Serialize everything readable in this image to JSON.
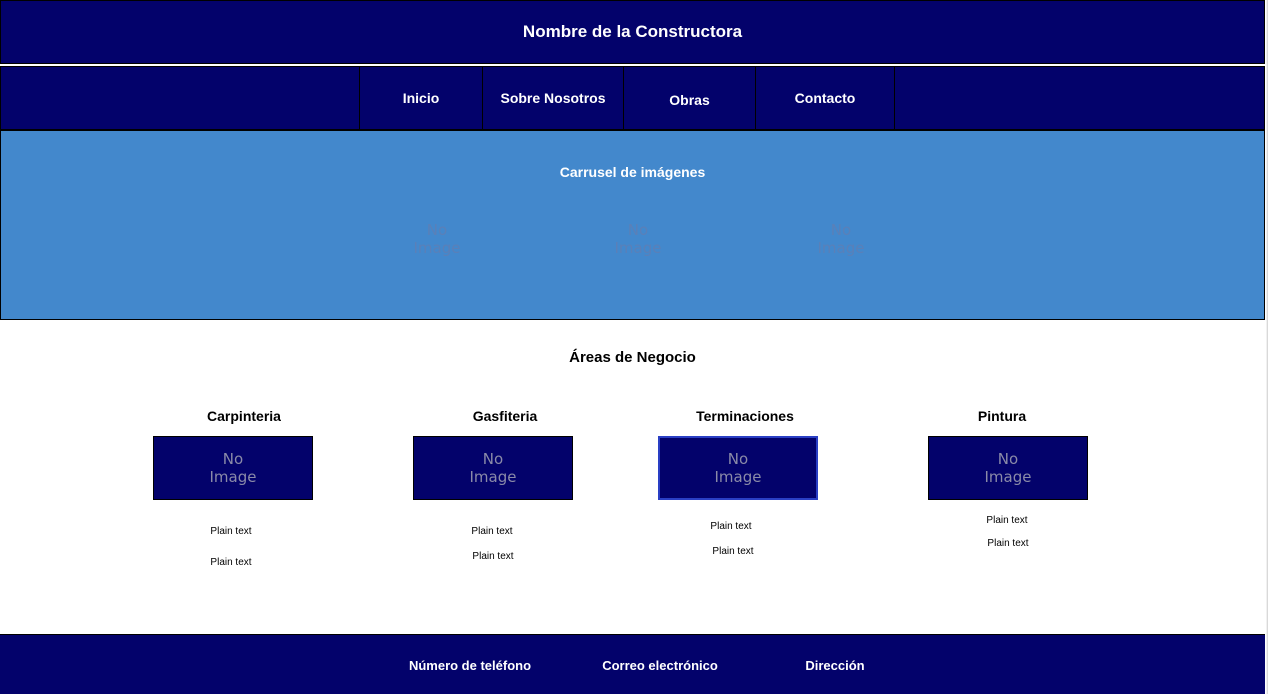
{
  "header": {
    "title": "Nombre de la Constructora"
  },
  "nav": {
    "items": [
      "Inicio",
      "Sobre Nosotros",
      "Obras",
      "Contacto"
    ]
  },
  "carousel": {
    "title": "Carrusel de imágenes",
    "placeholder": "No Image"
  },
  "areas": {
    "title": "Áreas de Negocio",
    "items": [
      {
        "name": "Carpinteria",
        "image": "No Image",
        "text1": "Plain text",
        "text2": "Plain text"
      },
      {
        "name": "Gasfiteria",
        "image": "No Image",
        "text1": "Plain text",
        "text2": "Plain text"
      },
      {
        "name": "Terminaciones",
        "image": "No Image",
        "text1": "Plain text",
        "text2": "Plain text"
      },
      {
        "name": "Pintura",
        "image": "No Image",
        "text1": "Plain text",
        "text2": "Plain text"
      }
    ]
  },
  "footer": {
    "phone": "Número de teléfono",
    "email": "Correo electrónico",
    "address": "Dirección"
  },
  "colors": {
    "navy": "#03026b",
    "carousel": "#4388cc"
  }
}
